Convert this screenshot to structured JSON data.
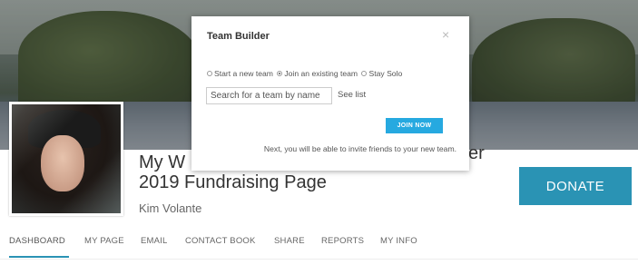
{
  "modal": {
    "title": "Team Builder",
    "close_glyph": "×",
    "options": [
      {
        "label": "Start a new team",
        "checked": false
      },
      {
        "label": "Join an existing team",
        "checked": true
      },
      {
        "label": "Stay Solo",
        "checked": false
      }
    ],
    "search_placeholder": "Search for a team by name",
    "see_list_label": "See list",
    "join_button_label": "JOIN NOW",
    "note": "Next, you will be able to invite friends to your new team."
  },
  "page": {
    "title_line1_left": "My W",
    "title_line1_right": "cer",
    "title_line2": "2019 Fundraising Page",
    "owner_name": "Kim Volante",
    "donate_label": "DONATE"
  },
  "nav": {
    "items": [
      "DASHBOARD",
      "MY PAGE",
      "EMAIL",
      "CONTACT BOOK",
      "SHARE",
      "REPORTS",
      "MY INFO"
    ],
    "active": "DASHBOARD"
  },
  "colors": {
    "accent": "#2a93b4",
    "join_button": "#26a9e0"
  },
  "icons": {
    "close": "close-icon",
    "radio": "radio-icon"
  }
}
